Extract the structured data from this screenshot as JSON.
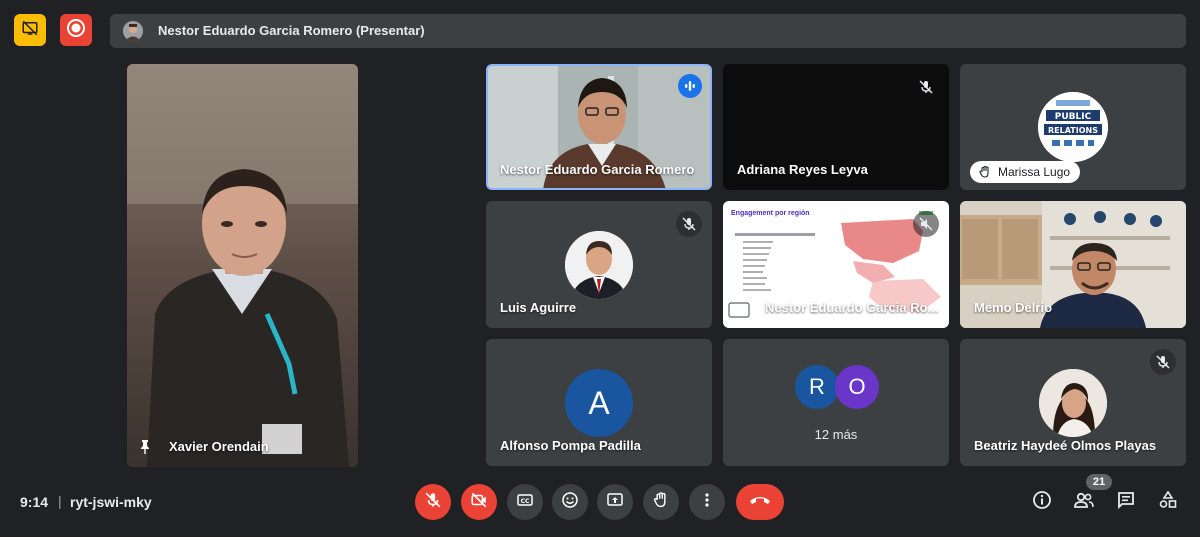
{
  "top_bar": {
    "presenter_label": "Nestor Eduardo Garcia Romero (Presentar)"
  },
  "colors": {
    "background": "#202124",
    "tile": "#3c4043",
    "accent_blue": "#8ab4f8",
    "red": "#ea4335",
    "yellow": "#fbbc04"
  },
  "pinned": {
    "name": "Xavier Orendain"
  },
  "tiles": [
    {
      "name": "Nestor Eduardo Garcia Romero",
      "state": "speaking"
    },
    {
      "name": "Adriana Reyes Leyva",
      "state": "muted"
    },
    {
      "name": "Marissa Lugo",
      "state": "camera-off"
    },
    {
      "name": "Luis Aguirre",
      "state": "muted"
    },
    {
      "name": "Nestor Eduardo Garcia Ro...",
      "state": "presenting",
      "slide_title": "Engagement por región"
    },
    {
      "name": "Memo Delrio",
      "state": "video"
    },
    {
      "name": "Alfonso Pompa Padilla",
      "initial": "A"
    },
    {
      "initials": [
        "R",
        "O"
      ],
      "more_label": "12 más"
    },
    {
      "name": "Beatriz Haydeé Olmos Playas",
      "state": "muted"
    }
  ],
  "bottom_bar": {
    "time": "9:14",
    "separator": "|",
    "meeting_code": "ryt-jswi-mky",
    "participant_count": "21"
  }
}
